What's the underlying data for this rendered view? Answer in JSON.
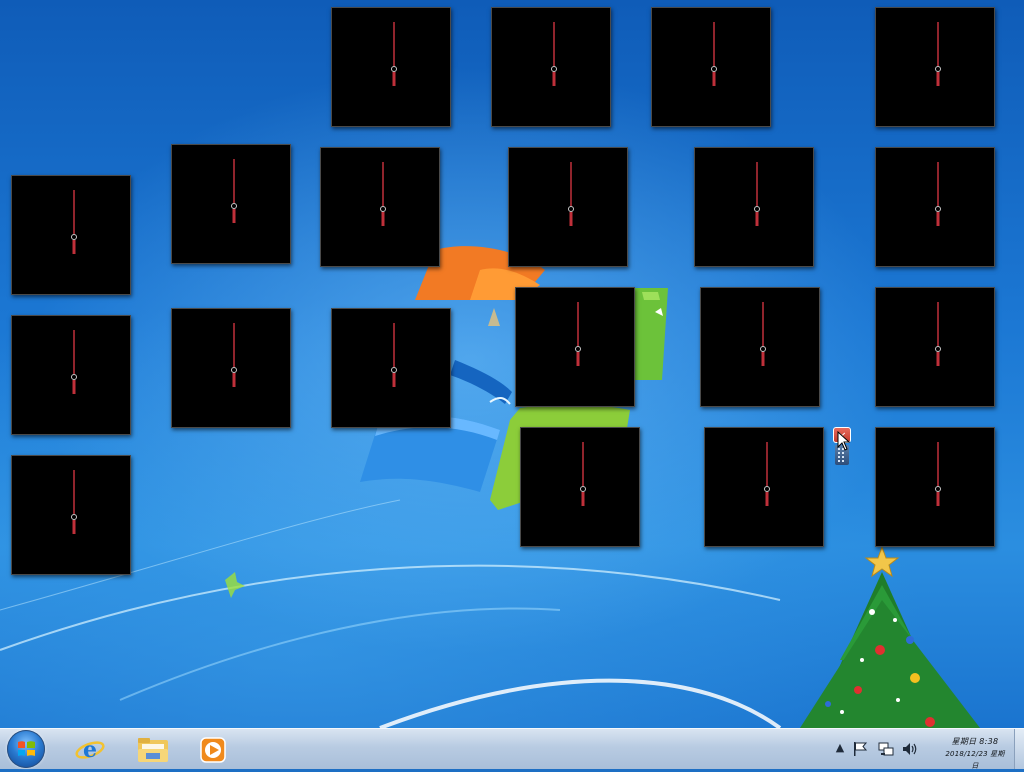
{
  "desktop": {
    "wallpaper": "windows-7-default",
    "accent_color": "#1d6fc4",
    "gadgets": {
      "type": "clock",
      "count": 20,
      "background": "#000000",
      "hand_color": "#c0303a"
    },
    "gadget_controls": {
      "close_icon": "close-icon",
      "grip_icon": "drag-handle-icon"
    }
  },
  "taskbar": {
    "start_icon": "windows-logo-icon",
    "pinned": [
      {
        "name": "Internet Explorer",
        "icon": "internet-explorer-icon"
      },
      {
        "name": "Windows Explorer",
        "icon": "folder-icon"
      },
      {
        "name": "Windows Media Player",
        "icon": "media-player-icon"
      }
    ],
    "tray": {
      "show_hidden_glyph": "▲",
      "icons": [
        "flag-icon",
        "network-icon",
        "volume-icon"
      ],
      "clock": {
        "time": "星期日 8:38",
        "date": "2018/12/23 星期日"
      }
    }
  }
}
